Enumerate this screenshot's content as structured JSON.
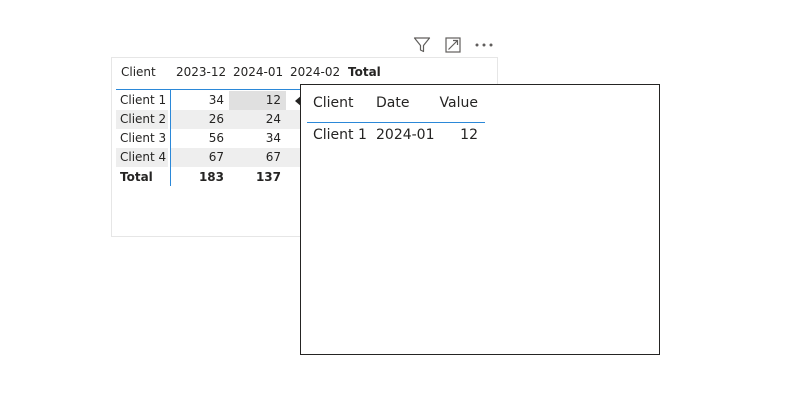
{
  "header_icons": [
    "filter-icon",
    "focus-mode-icon",
    "more-options-icon"
  ],
  "matrix": {
    "columns": [
      "Client",
      "2023-12",
      "2024-01",
      "2024-02",
      "Total"
    ],
    "rows": [
      {
        "label": "Client 1",
        "values": [
          "34",
          "12"
        ]
      },
      {
        "label": "Client 2",
        "values": [
          "26",
          "24"
        ]
      },
      {
        "label": "Client 3",
        "values": [
          "56",
          "34"
        ]
      },
      {
        "label": "Client 4",
        "values": [
          "67",
          "67"
        ]
      }
    ],
    "total": {
      "label": "Total",
      "values": [
        "183",
        "137"
      ]
    },
    "accent_color": "#2b88d8"
  },
  "tooltip": {
    "columns": [
      "Client",
      "Date",
      "Value"
    ],
    "row": [
      "Client 1",
      "2024-01",
      "12"
    ]
  }
}
